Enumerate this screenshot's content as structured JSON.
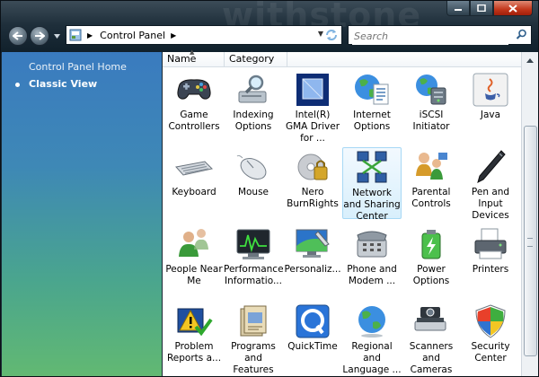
{
  "window": {
    "watermark": "withstone",
    "address": {
      "path": "Control Panel"
    },
    "search": {
      "placeholder": "Search"
    }
  },
  "sidebar": {
    "items": [
      {
        "label": "Control Panel Home"
      },
      {
        "label": "Classic View"
      }
    ]
  },
  "columns": [
    {
      "label": "Name"
    },
    {
      "label": "Category"
    }
  ],
  "items": [
    {
      "label": "Game Controllers",
      "icon": "gamepad-icon"
    },
    {
      "label": "Indexing Options",
      "icon": "indexing-icon"
    },
    {
      "label": "Intel(R) GMA Driver for ...",
      "icon": "intel-gma-icon"
    },
    {
      "label": "Internet Options",
      "icon": "internet-options-icon"
    },
    {
      "label": "iSCSI Initiator",
      "icon": "iscsi-icon"
    },
    {
      "label": "Java",
      "icon": "java-icon"
    },
    {
      "label": "Keyboard",
      "icon": "keyboard-icon"
    },
    {
      "label": "Mouse",
      "icon": "mouse-icon"
    },
    {
      "label": "Nero BurnRights",
      "icon": "nero-icon"
    },
    {
      "label": "Network and Sharing Center",
      "icon": "network-icon"
    },
    {
      "label": "Parental Controls",
      "icon": "parental-icon"
    },
    {
      "label": "Pen and Input Devices",
      "icon": "pen-icon"
    },
    {
      "label": "People Near Me",
      "icon": "people-icon"
    },
    {
      "label": "Performance Informatio...",
      "icon": "performance-icon"
    },
    {
      "label": "Personaliz...",
      "icon": "personalize-icon"
    },
    {
      "label": "Phone and Modem ...",
      "icon": "phone-icon"
    },
    {
      "label": "Power Options",
      "icon": "power-icon"
    },
    {
      "label": "Printers",
      "icon": "printer-icon"
    },
    {
      "label": "Problem Reports a...",
      "icon": "problem-reports-icon"
    },
    {
      "label": "Programs and Features",
      "icon": "programs-icon"
    },
    {
      "label": "QuickTime",
      "icon": "quicktime-icon"
    },
    {
      "label": "Regional and Language ...",
      "icon": "regional-icon"
    },
    {
      "label": "Scanners and Cameras",
      "icon": "scanner-icon"
    },
    {
      "label": "Security Center",
      "icon": "security-icon"
    }
  ],
  "colors": {
    "sidebar_top": "#3a7bbf",
    "sidebar_bottom": "#62b972",
    "selection": "#d8effc"
  }
}
